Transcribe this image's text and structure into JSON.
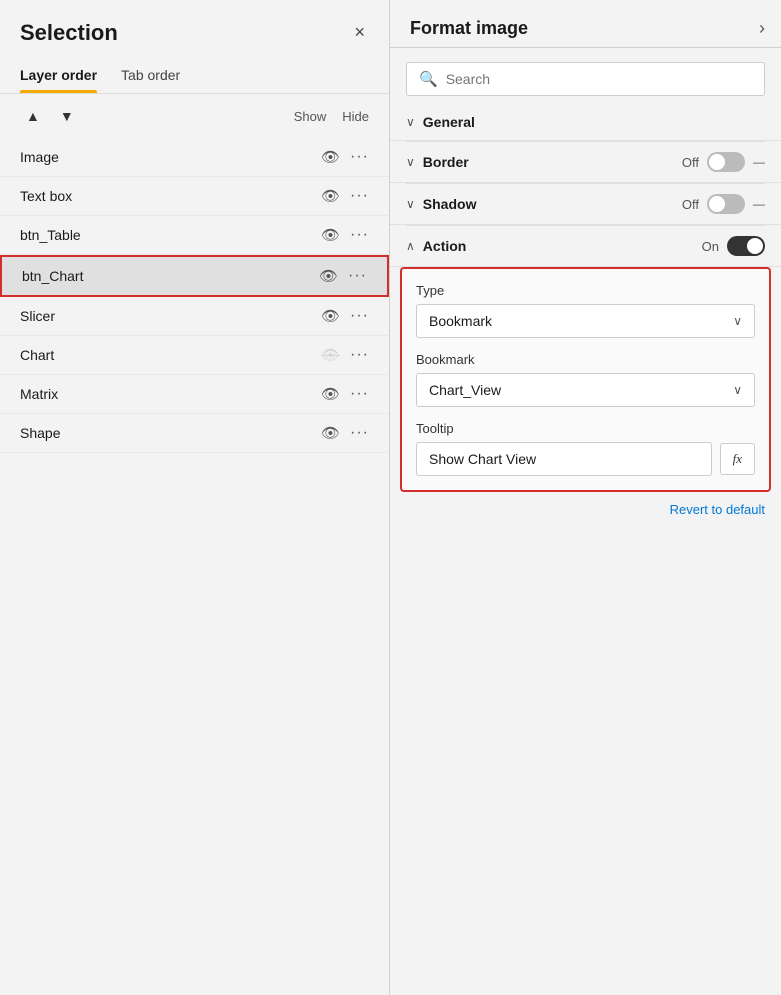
{
  "left_panel": {
    "title": "Selection",
    "close_label": "×",
    "tabs": [
      {
        "id": "layer",
        "label": "Layer order",
        "active": true
      },
      {
        "id": "tab",
        "label": "Tab order",
        "active": false
      }
    ],
    "controls": {
      "up_arrow": "▲",
      "down_arrow": "▼",
      "show_label": "Show",
      "hide_label": "Hide"
    },
    "layers": [
      {
        "id": "image",
        "name": "Image",
        "visible": true,
        "selected": false
      },
      {
        "id": "textbox",
        "name": "Text box",
        "visible": true,
        "selected": false
      },
      {
        "id": "btn_table",
        "name": "btn_Table",
        "visible": true,
        "selected": false
      },
      {
        "id": "btn_chart",
        "name": "btn_Chart",
        "visible": true,
        "selected": true
      },
      {
        "id": "slicer",
        "name": "Slicer",
        "visible": true,
        "selected": false
      },
      {
        "id": "chart",
        "name": "Chart",
        "visible": false,
        "selected": false
      },
      {
        "id": "matrix",
        "name": "Matrix",
        "visible": true,
        "selected": false
      },
      {
        "id": "shape",
        "name": "Shape",
        "visible": true,
        "selected": false
      }
    ]
  },
  "right_panel": {
    "title": "Format image",
    "nav_arrow": "›",
    "search": {
      "placeholder": "Search",
      "icon": "🔍"
    },
    "sections": [
      {
        "id": "general",
        "label": "General",
        "expanded": false,
        "has_toggle": false
      },
      {
        "id": "border",
        "label": "Border",
        "expanded": false,
        "has_toggle": true,
        "toggle_state": "off",
        "toggle_label": "Off"
      },
      {
        "id": "shadow",
        "label": "Shadow",
        "expanded": false,
        "has_toggle": true,
        "toggle_state": "off",
        "toggle_label": "Off"
      },
      {
        "id": "action",
        "label": "Action",
        "expanded": true,
        "has_toggle": true,
        "toggle_state": "on",
        "toggle_label": "On"
      }
    ],
    "action_section": {
      "type_label": "Type",
      "type_value": "Bookmark",
      "bookmark_label": "Bookmark",
      "bookmark_value": "Chart_View",
      "tooltip_label": "Tooltip",
      "tooltip_value": "Show Chart View",
      "fx_label": "fx"
    },
    "revert_label": "Revert to default"
  }
}
